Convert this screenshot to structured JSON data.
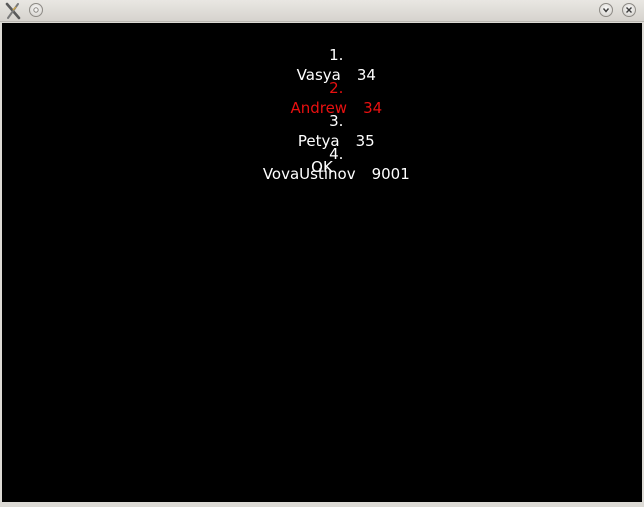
{
  "window": {
    "icons": {
      "app": "app-x-icon",
      "keep_above": "circle-icon",
      "minimize": "chevron-down-icon",
      "close": "close-icon"
    }
  },
  "highscores": [
    {
      "rank": "1.",
      "name": "Vasya",
      "score": "34",
      "selected": false
    },
    {
      "rank": "2.",
      "name": "Andrew",
      "score": "34",
      "selected": true
    },
    {
      "rank": "3.",
      "name": "Petya",
      "score": "35",
      "selected": false
    },
    {
      "rank": "4.",
      "name": "VovaUstinov",
      "score": "9001",
      "selected": false
    }
  ],
  "ok_label": "OK",
  "colors": {
    "background": "#000000",
    "text": "#ffffff",
    "selected": "#e81010"
  }
}
